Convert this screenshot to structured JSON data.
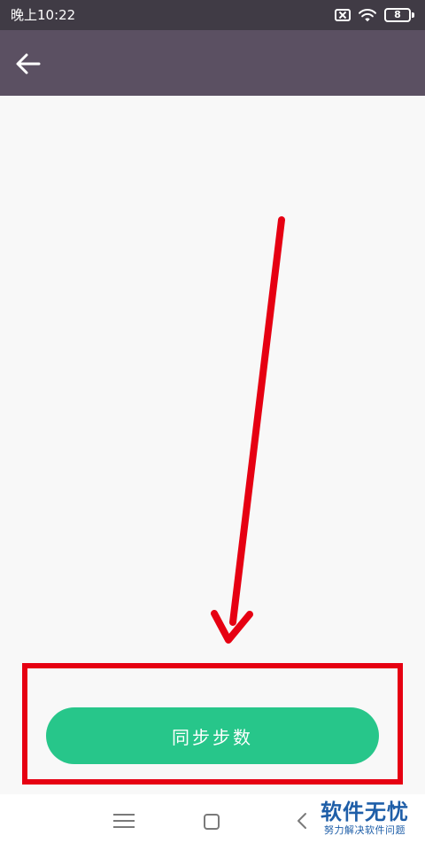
{
  "status_bar": {
    "time": "晚上10:22",
    "battery_level": "8"
  },
  "icons": {
    "back": "back-arrow-icon",
    "notification_off": "sim-off-icon",
    "wifi": "wifi-icon",
    "battery": "battery-icon",
    "nav_menu": "menu-icon",
    "nav_home": "home-icon",
    "nav_back": "chevron-left-icon"
  },
  "main": {
    "sync_button_label": "同步步数"
  },
  "watermark": {
    "title": "软件无忧",
    "subtitle": "努力解决软件问题"
  },
  "colors": {
    "status_bar": "#403b45",
    "top_bar": "#5b5062",
    "background": "#f8f8f8",
    "button": "#27c68a",
    "annotation": "#e60012",
    "watermark": "#1e5ea8"
  }
}
